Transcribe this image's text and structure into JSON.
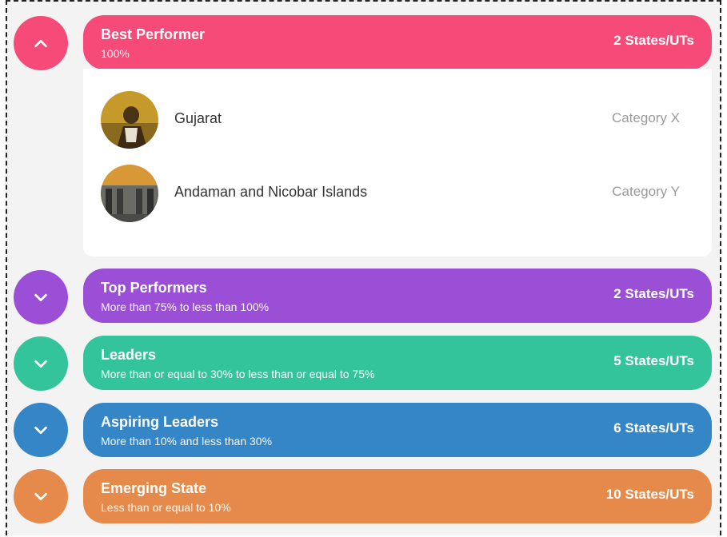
{
  "colors": {
    "best": "#f64b78",
    "top": "#9a4fd6",
    "leaders": "#33c49b",
    "aspiring": "#3586c7",
    "emerging": "#e58a4a"
  },
  "groups": [
    {
      "id": "best",
      "title": "Best Performer",
      "range": "100%",
      "count": "2 States/UTs",
      "expanded": true,
      "icon": "chevron-up-icon"
    },
    {
      "id": "top",
      "title": "Top Performers",
      "range": "More than 75% to less than 100%",
      "count": "2 States/UTs",
      "expanded": false,
      "icon": "chevron-down-icon"
    },
    {
      "id": "leaders",
      "title": "Leaders",
      "range": "More than or equal to 30% to less than or equal to 75%",
      "count": "5 States/UTs",
      "expanded": false,
      "icon": "chevron-down-icon"
    },
    {
      "id": "aspiring",
      "title": "Aspiring Leaders",
      "range": "More than 10% and less than 30%",
      "count": "6 States/UTs",
      "expanded": false,
      "icon": "chevron-down-icon"
    },
    {
      "id": "emerging",
      "title": "Emerging State",
      "range": "Less than or equal to 10%",
      "count": "10 States/UTs",
      "expanded": false,
      "icon": "chevron-down-icon"
    }
  ],
  "best_items": [
    {
      "name": "Gujarat",
      "category": "Category X"
    },
    {
      "name": "Andaman and Nicobar Islands",
      "category": "Category Y"
    }
  ]
}
